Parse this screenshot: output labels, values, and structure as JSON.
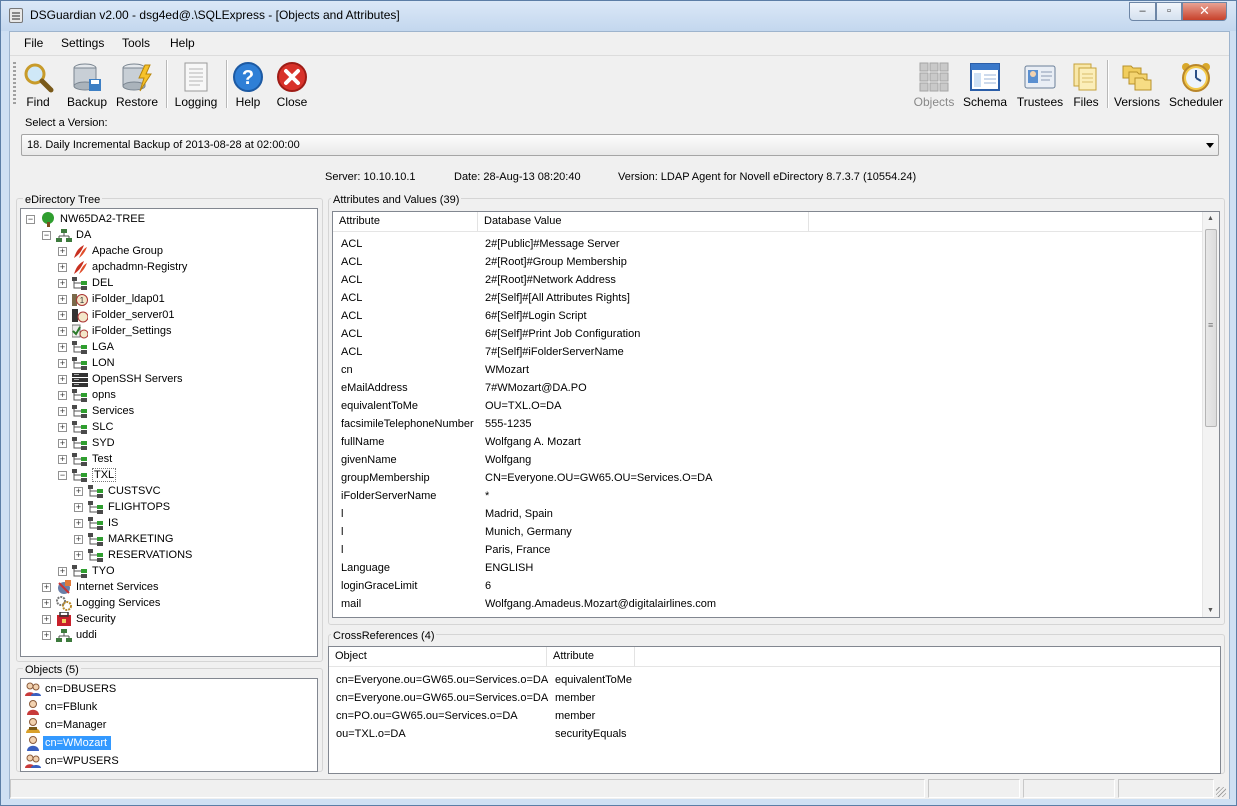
{
  "window": {
    "title": "DSGuardian v2.00 - dsg4ed@.\\SQLExpress - [Objects and Attributes]",
    "min_glyph": "–",
    "max_glyph": "▫",
    "close_glyph": "✕"
  },
  "menu": [
    "File",
    "Settings",
    "Tools",
    "Help"
  ],
  "toolbar": {
    "left": [
      {
        "label": "Find",
        "icon": "magnifier-icon"
      },
      {
        "label": "Backup",
        "icon": "database-backup-icon"
      },
      {
        "label": "Restore",
        "icon": "database-restore-icon"
      },
      {
        "label": "Logging",
        "icon": "log-document-icon"
      },
      {
        "label": "Help",
        "icon": "help-icon"
      },
      {
        "label": "Close",
        "icon": "close-circle-icon"
      }
    ],
    "right": [
      {
        "label": "Objects",
        "icon": "objects-grid-icon",
        "disabled": true
      },
      {
        "label": "Schema",
        "icon": "schema-window-icon"
      },
      {
        "label": "Trustees",
        "icon": "trustees-card-icon"
      },
      {
        "label": "Files",
        "icon": "files-icon"
      },
      {
        "label": "Versions",
        "icon": "versions-folders-icon"
      },
      {
        "label": "Scheduler",
        "icon": "alarm-clock-icon"
      }
    ]
  },
  "version": {
    "label": "Select a Version:",
    "selected": "18. Daily Incremental Backup of 2013-08-28 at 02:00:00"
  },
  "info": {
    "server": "Server: 10.10.10.1",
    "date": "Date: 28-Aug-13 08:20:40",
    "version": "Version: LDAP Agent for Novell eDirectory 8.7.3.7 (10554.24)"
  },
  "tree": {
    "title": "eDirectory Tree",
    "root": "NW65DA2-TREE",
    "nodes": [
      {
        "label": "DA",
        "level": 1,
        "expander": "-",
        "icon": "org-icon"
      },
      {
        "label": "Apache Group",
        "level": 2,
        "expander": "+",
        "icon": "feather-icon"
      },
      {
        "label": "apchadmn-Registry",
        "level": 2,
        "expander": "+",
        "icon": "feather-icon"
      },
      {
        "label": "DEL",
        "level": 2,
        "expander": "+",
        "icon": "ou-icon"
      },
      {
        "label": "iFolder_ldap01",
        "level": 2,
        "expander": "+",
        "icon": "ifolder-icon"
      },
      {
        "label": "iFolder_server01",
        "level": 2,
        "expander": "+",
        "icon": "ifolder-server-icon"
      },
      {
        "label": "iFolder_Settings",
        "level": 2,
        "expander": "+",
        "icon": "ifolder-settings-icon"
      },
      {
        "label": "LGA",
        "level": 2,
        "expander": "+",
        "icon": "ou-icon"
      },
      {
        "label": "LON",
        "level": 2,
        "expander": "+",
        "icon": "ou-icon"
      },
      {
        "label": "OpenSSH Servers",
        "level": 2,
        "expander": "+",
        "icon": "server-rack-icon"
      },
      {
        "label": "opns",
        "level": 2,
        "expander": "+",
        "icon": "ou-icon"
      },
      {
        "label": "Services",
        "level": 2,
        "expander": "+",
        "icon": "ou-icon"
      },
      {
        "label": "SLC",
        "level": 2,
        "expander": "+",
        "icon": "ou-icon"
      },
      {
        "label": "SYD",
        "level": 2,
        "expander": "+",
        "icon": "ou-icon"
      },
      {
        "label": "Test",
        "level": 2,
        "expander": "+",
        "icon": "ou-icon"
      },
      {
        "label": "TXL",
        "level": 2,
        "expander": "-",
        "icon": "ou-icon",
        "selected_box": true
      },
      {
        "label": "CUSTSVC",
        "level": 3,
        "expander": "+",
        "icon": "ou-icon"
      },
      {
        "label": "FLIGHTOPS",
        "level": 3,
        "expander": "+",
        "icon": "ou-icon"
      },
      {
        "label": "IS",
        "level": 3,
        "expander": "+",
        "icon": "ou-icon"
      },
      {
        "label": "MARKETING",
        "level": 3,
        "expander": "+",
        "icon": "ou-icon"
      },
      {
        "label": "RESERVATIONS",
        "level": 3,
        "expander": "+",
        "icon": "ou-icon"
      },
      {
        "label": "TYO",
        "level": 2,
        "expander": "+",
        "icon": "ou-icon"
      },
      {
        "label": "Internet Services",
        "level": 1,
        "expander": "+",
        "icon": "internet-services-icon"
      },
      {
        "label": "Logging Services",
        "level": 1,
        "expander": "+",
        "icon": "logging-services-icon"
      },
      {
        "label": "Security",
        "level": 1,
        "expander": "+",
        "icon": "security-icon"
      },
      {
        "label": "uddi",
        "level": 1,
        "expander": "+",
        "icon": "org-icon"
      }
    ]
  },
  "objects": {
    "title": "Objects (5)",
    "items": [
      {
        "label": "cn=DBUSERS",
        "icon": "group-icon"
      },
      {
        "label": "cn=FBlunk",
        "icon": "user-icon"
      },
      {
        "label": "cn=Manager",
        "icon": "manager-icon"
      },
      {
        "label": "cn=WMozart",
        "icon": "user-blue-icon",
        "selected": true
      },
      {
        "label": "cn=WPUSERS",
        "icon": "group-icon"
      }
    ]
  },
  "attributes": {
    "title": "Attributes and Values (39)",
    "col_attr": "Attribute",
    "col_value": "Database Value",
    "rows": [
      [
        "ACL",
        "2#[Public]#Message Server"
      ],
      [
        "ACL",
        "2#[Root]#Group Membership"
      ],
      [
        "ACL",
        "2#[Root]#Network Address"
      ],
      [
        "ACL",
        "2#[Self]#[All Attributes Rights]"
      ],
      [
        "ACL",
        "6#[Self]#Login Script"
      ],
      [
        "ACL",
        "6#[Self]#Print Job Configuration"
      ],
      [
        "ACL",
        "7#[Self]#iFolderServerName"
      ],
      [
        "cn",
        "WMozart"
      ],
      [
        "eMailAddress",
        "7#WMozart@DA.PO"
      ],
      [
        "equivalentToMe",
        "OU=TXL.O=DA"
      ],
      [
        "facsimileTelephoneNumber",
        "555-1235"
      ],
      [
        "fullName",
        "Wolfgang A. Mozart"
      ],
      [
        "givenName",
        "Wolfgang"
      ],
      [
        "groupMembership",
        "CN=Everyone.OU=GW65.OU=Services.O=DA"
      ],
      [
        "iFolderServerName",
        "*"
      ],
      [
        "l",
        "Madrid, Spain"
      ],
      [
        "l",
        "Munich, Germany"
      ],
      [
        "l",
        "Paris, France"
      ],
      [
        "Language",
        "ENGLISH"
      ],
      [
        "loginGraceLimit",
        "6"
      ],
      [
        "mail",
        "Wolfgang.Amadeus.Mozart@digitalairlines.com"
      ]
    ]
  },
  "crossrefs": {
    "title": "CrossReferences (4)",
    "col_object": "Object",
    "col_attr": "Attribute",
    "rows": [
      [
        "cn=Everyone.ou=GW65.ou=Services.o=DA",
        "equivalentToMe"
      ],
      [
        "cn=Everyone.ou=GW65.ou=Services.o=DA",
        "member"
      ],
      [
        "cn=PO.ou=GW65.ou=Services.o=DA",
        "member"
      ],
      [
        "ou=TXL.o=DA",
        "securityEquals"
      ]
    ]
  },
  "scroll": {
    "up": "▲",
    "down": "▼",
    "grip": "≡"
  },
  "colors": {
    "selection": "#3399ff",
    "titlebar": "#c9dbf0",
    "tree_green": "#2f9e2f"
  }
}
